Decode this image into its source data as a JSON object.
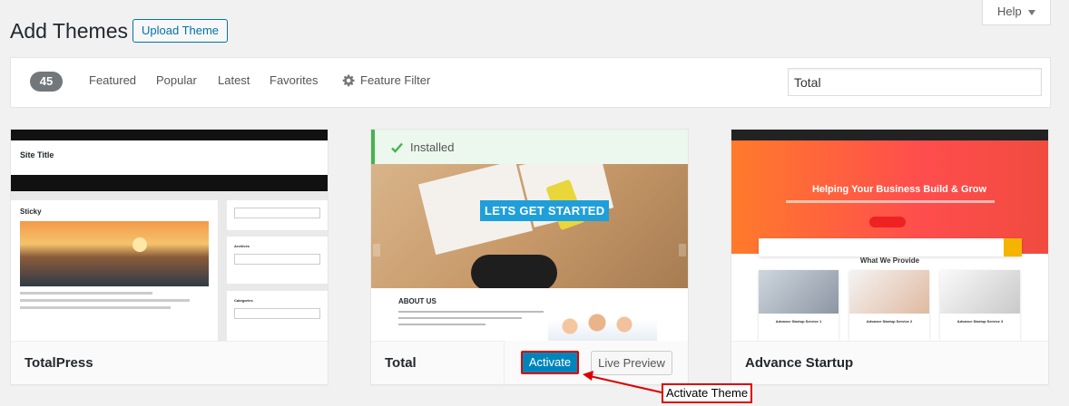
{
  "header": {
    "title": "Add Themes",
    "upload_label": "Upload Theme",
    "help_label": "Help"
  },
  "filter": {
    "count": "45",
    "links": [
      "Featured",
      "Popular",
      "Latest",
      "Favorites"
    ],
    "feature_filter_label": "Feature Filter",
    "search_value": "Total"
  },
  "themes": [
    {
      "name": "TotalPress",
      "preview": {
        "site_title": "Site Title",
        "post_title": "Sticky",
        "sidebar_archives": "Archives",
        "sidebar_categories": "Categories"
      }
    },
    {
      "name": "Total",
      "installed_label": "Installed",
      "activate_label": "Activate",
      "live_preview_label": "Live Preview",
      "preview": {
        "hero_title": "LETS GET STARTED",
        "about_heading": "ABOUT US"
      }
    },
    {
      "name": "Advance Startup",
      "preview": {
        "headline": "Helping Your Business Build & Grow",
        "section_title": "What We Provide",
        "service_1": "Advance Startup Service 1",
        "service_2": "Advance Startup Service 2",
        "service_3": "Advance Startup Service 3"
      }
    }
  ],
  "annotation": {
    "label": "Activate Theme",
    "color": "#dd0000"
  },
  "colors": {
    "primary": "#0085ba",
    "installed_green": "#46b450",
    "background": "#f1f1f1"
  }
}
